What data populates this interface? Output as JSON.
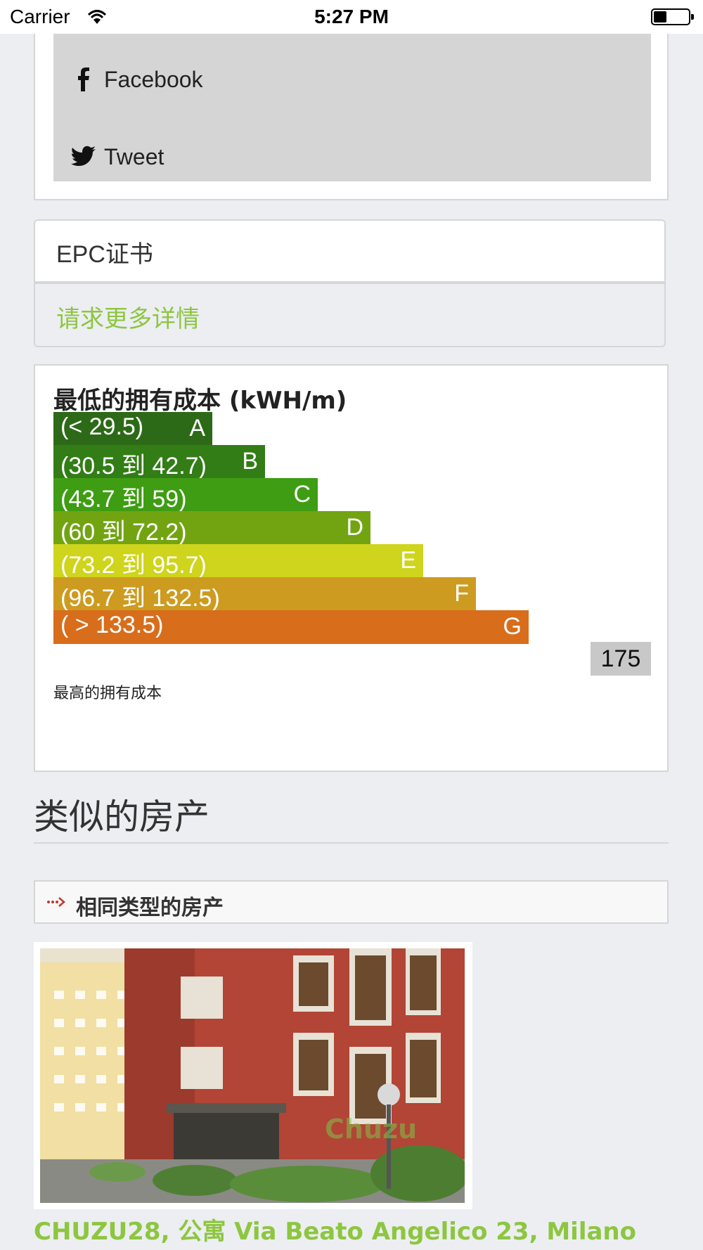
{
  "status_bar": {
    "carrier": "Carrier",
    "time": "5:27 PM"
  },
  "share": {
    "facebook_label": "Facebook",
    "tweet_label": "Tweet"
  },
  "epc": {
    "title": "EPC证书",
    "request_link": "请求更多详情"
  },
  "energy": {
    "title": "最低的拥有成本 (kWH/m)",
    "footer": "最高的拥有成本",
    "current_value": "175",
    "bands": [
      {
        "range": "(< 29.5)",
        "letter": "A",
        "color": "#2d6a18"
      },
      {
        "range": "(30.5 到 42.7)",
        "letter": "B",
        "color": "#327d16"
      },
      {
        "range": "(43.7 到 59)",
        "letter": "C",
        "color": "#3e9d12"
      },
      {
        "range": "(60 到 72.2)",
        "letter": "D",
        "color": "#72a412"
      },
      {
        "range": "(73.2 到 95.7)",
        "letter": "E",
        "color": "#cfd41c"
      },
      {
        "range": "(96.7 到 132.5)",
        "letter": "F",
        "color": "#cd9b1f"
      },
      {
        "range": "( > 133.5)",
        "letter": "G",
        "color": "#d86d1b"
      }
    ]
  },
  "similar": {
    "title": "类似的房产",
    "same_type_label": "相同类型的房产",
    "listing_title": "CHUZU28, 公寓 Via Beato Angelico 23, Milano",
    "watermark": "Chuzu"
  },
  "colors": {
    "accent": "#8dc63f",
    "arrow": "#c0392b"
  }
}
